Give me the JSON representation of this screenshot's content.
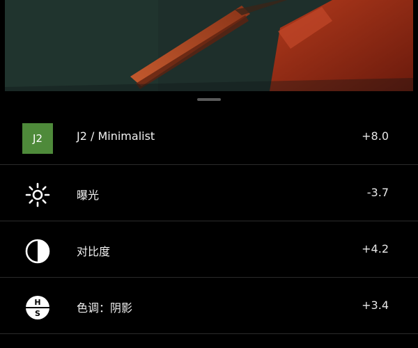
{
  "colors": {
    "background": "#000000",
    "badge": "#4e8a3a",
    "text": "#f2f2f2",
    "divider": "#2b2b2b"
  },
  "preview": {
    "icon": "photo-preview"
  },
  "adjustments": [
    {
      "icon": "j2-filter-badge",
      "badge_text": "J2",
      "label": "J2 / Minimalist",
      "value": "+8.0"
    },
    {
      "icon": "sun-icon",
      "label": "曝光",
      "value": "-3.7"
    },
    {
      "icon": "contrast-icon",
      "label": "对比度",
      "value": "+4.2"
    },
    {
      "icon": "hs-icon",
      "icon_letters": [
        "H",
        "S"
      ],
      "label": "色调：阴影",
      "value": "+3.4"
    }
  ]
}
